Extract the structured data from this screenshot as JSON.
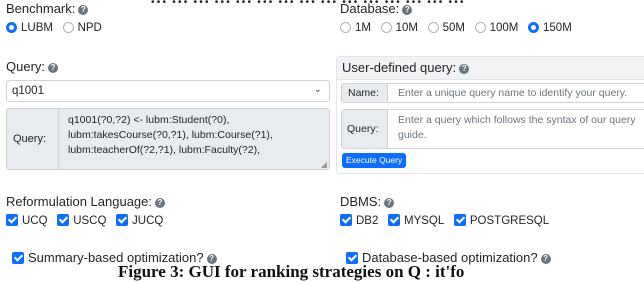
{
  "benchmark": {
    "label": "Benchmark:",
    "options": [
      {
        "label": "LUBM",
        "selected": true
      },
      {
        "label": "NPD",
        "selected": false
      }
    ]
  },
  "database": {
    "label": "Database:",
    "options": [
      {
        "label": "1M",
        "selected": false
      },
      {
        "label": "10M",
        "selected": false
      },
      {
        "label": "50M",
        "selected": false
      },
      {
        "label": "100M",
        "selected": false
      },
      {
        "label": "150M",
        "selected": true
      }
    ]
  },
  "query": {
    "label": "Query:",
    "selected": "q1001",
    "prefix": "Query:",
    "text": "q1001(?0,?2) <- lubm:Student(?0), lubm:takesCourse(?0,?1), lubm:Course(?1), lubm:teacherOf(?2,?1), lubm:Faculty(?2),"
  },
  "user_query": {
    "label": "User-defined query:",
    "name_label": "Name:",
    "name_placeholder": "Enter a unique query name to identify your query.",
    "query_label": "Query:",
    "query_placeholder": "Enter a query which follows the syntax of our query guide.",
    "execute_label": "Execute Query"
  },
  "reformulation": {
    "label": "Reformulation Language:",
    "options": [
      {
        "label": "UCQ",
        "checked": true
      },
      {
        "label": "USCQ",
        "checked": true
      },
      {
        "label": "JUCQ",
        "checked": true
      }
    ]
  },
  "dbms": {
    "label": "DBMS:",
    "options": [
      {
        "label": "DB2",
        "checked": true
      },
      {
        "label": "MYSQL",
        "checked": true
      },
      {
        "label": "POSTGRESQL",
        "checked": true
      }
    ]
  },
  "summary_opt": {
    "label": "Summary-based optimization?",
    "checked": true
  },
  "database_opt": {
    "label": "Database-based optimization?",
    "checked": true
  },
  "overlay_top": "… … … … … … … … … … … … … … …",
  "overlay_bottom": "Figure 3: GUI for ranking strategies on Q : it'fo"
}
